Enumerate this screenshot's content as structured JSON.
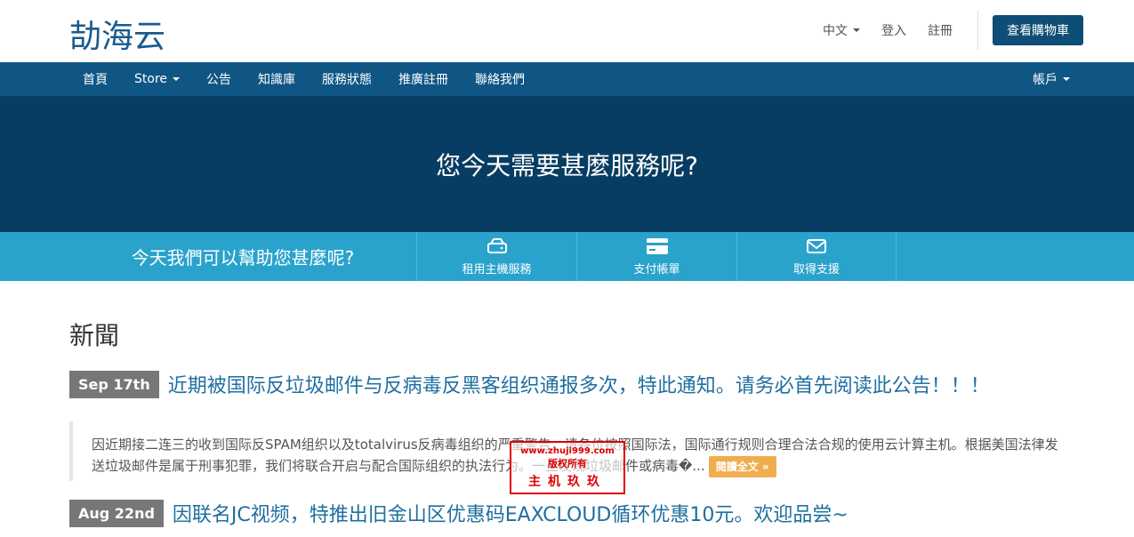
{
  "header": {
    "logo": "劼海云",
    "language": "中文",
    "login": "登入",
    "register": "註冊",
    "cart": "查看購物車"
  },
  "nav": {
    "items": [
      "首頁",
      "Store",
      "公告",
      "知識庫",
      "服務狀態",
      "推廣註冊",
      "聯絡我們"
    ],
    "account": "帳戶"
  },
  "hero": {
    "title": "您今天需要甚麼服務呢?"
  },
  "actions": {
    "help_text": "今天我們可以幫助您甚麼呢?",
    "tiles": [
      {
        "label": "租用主機服務",
        "icon": "server-icon"
      },
      {
        "label": "支付帳單",
        "icon": "credit-card-icon"
      },
      {
        "label": "取得支援",
        "icon": "envelope-icon"
      }
    ]
  },
  "news": {
    "heading": "新聞",
    "items": [
      {
        "date": "Sep 17th",
        "title": "近期被国际反垃圾邮件与反病毒反黑客组织通报多次，特此通知。请务必首先阅读此公告！！！",
        "excerpt": "因近期接二连三的收到国际反SPAM组织以及totalvirus反病毒组织的严重警告，请各位按照国际法，国际通行规则合理合法合规的使用云计算主机。根据美国法律发送垃圾邮件是属于刑事犯罪，我们将联合开启与配合国际组织的执法行为。一旦发现垃圾邮件或病毒�...",
        "read_more": "閱讀全文 »"
      },
      {
        "date": "Aug 22nd",
        "title": "因联名JC视频，特推出旧金山区优惠码EAXCLOUD循环优惠10元。欢迎品尝~"
      }
    ]
  },
  "watermark": {
    "line1": "www.zhuji999.com",
    "line2": "版权所有",
    "line3": "主机玖玖"
  },
  "colors": {
    "brand": "#1a5a8f",
    "nav_bg": "#0f5685",
    "hero_bg": "#073d62",
    "action_bg": "#2aa3cc",
    "read_more": "#f0ad4e"
  }
}
